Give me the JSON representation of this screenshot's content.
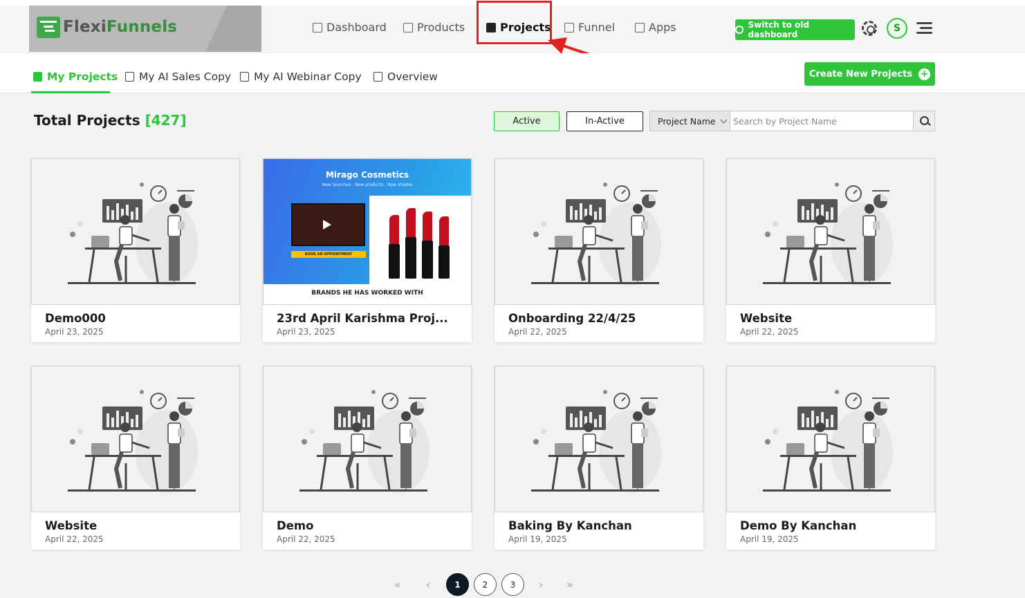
{
  "brand": {
    "name_part1": "Flexi",
    "name_part2": "Funnels"
  },
  "nav": {
    "items": [
      {
        "label": "Dashboard",
        "icon": "grid-icon"
      },
      {
        "label": "Products",
        "icon": "box-icon"
      },
      {
        "label": "Projects",
        "icon": "document-icon",
        "active": true
      },
      {
        "label": "Funnel",
        "icon": "funnel-icon"
      },
      {
        "label": "Apps",
        "icon": "apps-icon"
      }
    ],
    "switch_label": "Switch to old dashboard",
    "avatar_initial": "S"
  },
  "subtabs": [
    {
      "label": "My Projects",
      "active": true
    },
    {
      "label": "My AI Sales Copy"
    },
    {
      "label": "My AI Webinar Copy"
    },
    {
      "label": "Overview"
    }
  ],
  "create_label": "Create New Projects",
  "toolbar": {
    "total_label": "Total Projects",
    "total_count": "[427]",
    "active_label": "Active",
    "inactive_label": "In-Active",
    "filter_selected": "Project Name",
    "search_placeholder": "Search by Project Name"
  },
  "projects": [
    {
      "title": "Demo000",
      "date": "April 23, 2025"
    },
    {
      "title": "23rd April Karishma Proj...",
      "date": "April 23, 2025",
      "thumb": {
        "brand": "Mirago Cosmetics",
        "tagline": "New launches . New products . New shades",
        "cta": "BOOK AN APPOINTMENT",
        "footer": "BRANDS HE HAS WORKED WITH"
      }
    },
    {
      "title": "Onboarding 22/4/25",
      "date": "April 22, 2025"
    },
    {
      "title": "Website",
      "date": "April 22, 2025"
    },
    {
      "title": "Website",
      "date": "April 22, 2025"
    },
    {
      "title": "Demo",
      "date": "April 22, 2025"
    },
    {
      "title": "Baking By Kanchan",
      "date": "April 19, 2025"
    },
    {
      "title": "Demo By Kanchan",
      "date": "April 19, 2025"
    }
  ],
  "pagination": {
    "pages": [
      "1",
      "2",
      "3"
    ],
    "current": "1"
  },
  "colors": {
    "accent": "#2ec53b",
    "highlight": "#e0231f",
    "dark": "#0f1824"
  }
}
